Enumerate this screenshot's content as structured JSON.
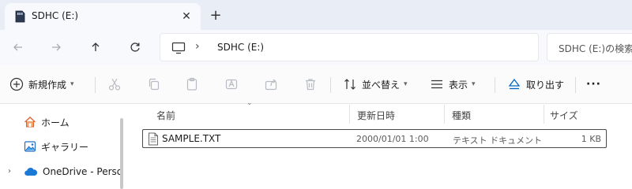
{
  "tab": {
    "title": "SDHC (E:)",
    "close_label": "✕",
    "new_tab_label": "+"
  },
  "address": {
    "path": "SDHC (E:)",
    "chevron": "›"
  },
  "search": {
    "placeholder": "SDHC (E:)の検索"
  },
  "toolbar": {
    "new_label": "新規作成",
    "sort_label": "並べ替え",
    "view_label": "表示",
    "eject_label": "取り出す",
    "more_label": "···"
  },
  "navpane": {
    "items": [
      {
        "label": "ホーム"
      },
      {
        "label": "ギャラリー"
      },
      {
        "label": "OneDrive - Perso"
      }
    ]
  },
  "columns": {
    "name": "名前",
    "date": "更新日時",
    "type": "種類",
    "size": "サイズ"
  },
  "files": [
    {
      "name": "SAMPLE.TXT",
      "date": "2000/01/01 1:00",
      "type": "テキスト ドキュメント",
      "size": "1 KB"
    }
  ],
  "colors": {
    "accent": "#0067c0",
    "titlebar": "#e8edf6",
    "navrow": "#f7f9fc"
  }
}
